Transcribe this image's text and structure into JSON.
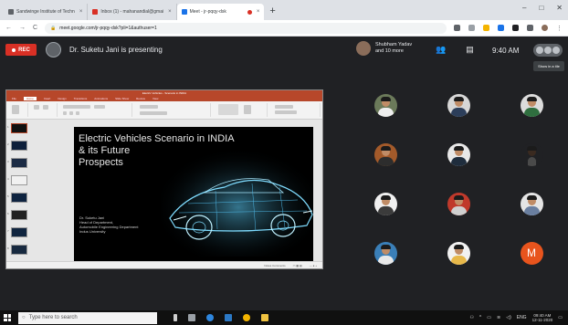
{
  "browser": {
    "tabs": [
      {
        "label": "Sandwinge Institute of Techn",
        "color": "#5f6368"
      },
      {
        "label": "Inbox (1) - mahanandial@gmai",
        "color": "#d93025"
      },
      {
        "label": "Meet - jr-pqqy-dsk",
        "color": "#1a73e8",
        "active": true
      }
    ],
    "new_tab": "+",
    "address": "meet.google.com/jr-pqqy-dsk?pli=1&authuser=1",
    "nav": {
      "back": "←",
      "forward": "→",
      "reload": "C"
    },
    "window_controls": {
      "minimize": "–",
      "maximize": "□",
      "close": "✕"
    }
  },
  "meet": {
    "rec_label": "REC",
    "presenter_text": "Dr. Suketu Jani is presenting",
    "participants_text_line1": "Shubham Yadav",
    "participants_text_line2": "and 10 more",
    "time": "9:40 AM",
    "tooltip": "Show in a tile",
    "participant_count": 12
  },
  "presentation": {
    "app_title": "Electric Vehicles - Scenario in INDIA",
    "ribbon_tabs": [
      "File",
      "Home",
      "Insert",
      "Design",
      "Transitions",
      "Animations",
      "Slide Show",
      "Review",
      "View"
    ],
    "slide_title": "Electric Vehicles  Scenario in INDIA\n& its Future\nProspects",
    "slide_author_lines": [
      "Dr. Suketu Jani",
      "Head of Department,",
      "Automobile Engineering Department",
      "Indus University"
    ],
    "thumbnail_numbers": [
      "1",
      "2",
      "3",
      "4",
      "5",
      "6",
      "7",
      "8"
    ],
    "status_text": "Notes   Comments"
  },
  "grid": {
    "tiles": [
      {
        "type": "face",
        "bg": "#6b7a5a",
        "shirt": "#eeeeee"
      },
      {
        "type": "face",
        "bg": "#d7d7d7",
        "shirt": "#2c3e5a"
      },
      {
        "type": "face",
        "bg": "#dcdcdc",
        "shirt": "#2f6f3f"
      },
      {
        "type": "face",
        "bg": "#a35a2a",
        "shirt": "#2d2d2d"
      },
      {
        "type": "face",
        "bg": "#e8e8e8",
        "shirt": "#1f2d3d"
      },
      {
        "type": "face",
        "bg": "#202124",
        "shirt": "#4a4a4a"
      },
      {
        "type": "face",
        "bg": "#f0f0f0",
        "shirt": "#3b3b3b"
      },
      {
        "type": "face",
        "bg": "#c0392b",
        "shirt": "#d0d0d0"
      },
      {
        "type": "face",
        "bg": "#e5e5e5",
        "shirt": "#6a7fa0"
      },
      {
        "type": "face",
        "bg": "#3a7fb8",
        "shirt": "#e9e9e9"
      },
      {
        "type": "face",
        "bg": "#f2f2f2",
        "shirt": "#e7b84a"
      },
      {
        "type": "initial",
        "letter": "M",
        "color": "#e8541d"
      }
    ]
  },
  "taskbar": {
    "search_placeholder": "Type here to search",
    "tray_lang": "ENG",
    "tray_time": "09:40 AM",
    "tray_date": "12-11-2020"
  }
}
